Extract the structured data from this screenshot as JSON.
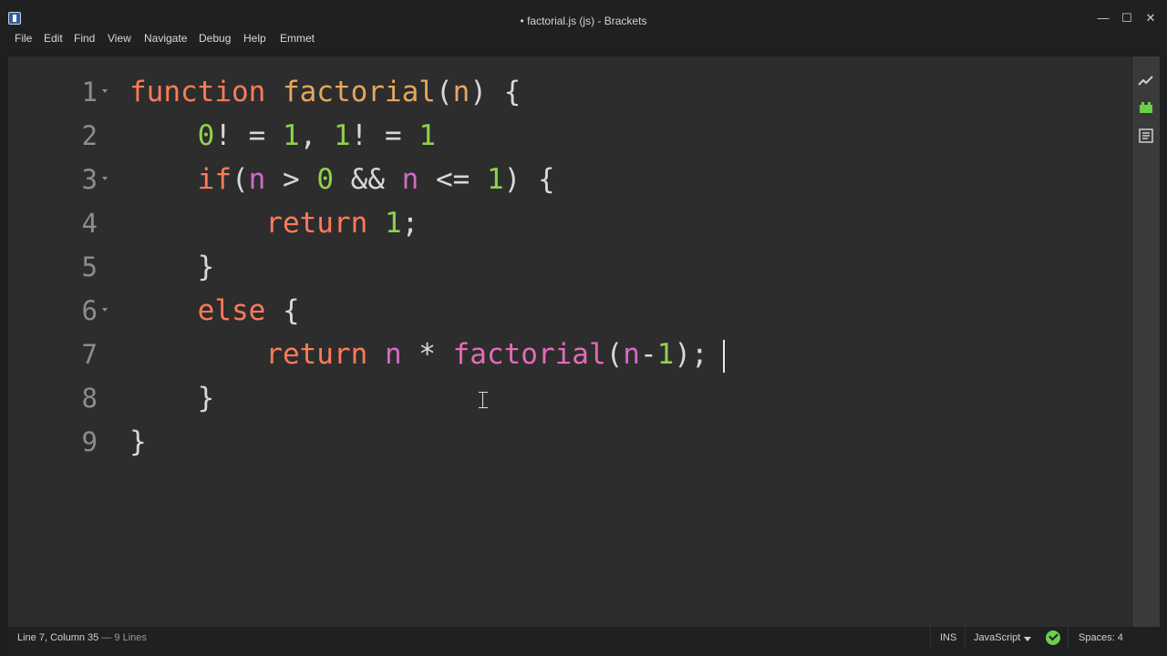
{
  "window": {
    "title": "• factorial.js (js) - Brackets",
    "controls": {
      "minimize": "—",
      "maximize": "☐",
      "close": "✕"
    }
  },
  "menu": [
    "File",
    "Edit",
    "Find",
    "View",
    "Navigate",
    "Debug",
    "Help",
    "Emmet"
  ],
  "editor": {
    "lines": [
      {
        "n": "1",
        "indent": "",
        "tokens": [
          [
            "kw",
            "function"
          ],
          [
            "op",
            " "
          ],
          [
            "fn",
            "factorial"
          ],
          [
            "op",
            "("
          ],
          [
            "fn",
            "n"
          ],
          [
            "op",
            ") {"
          ]
        ],
        "fold": true
      },
      {
        "n": "2",
        "indent": "    ",
        "tokens": [
          [
            "num",
            "0"
          ],
          [
            "op",
            "! = "
          ],
          [
            "num",
            "1"
          ],
          [
            "op",
            ", "
          ],
          [
            "num",
            "1"
          ],
          [
            "op",
            "! = "
          ],
          [
            "num",
            "1"
          ]
        ],
        "fold": false
      },
      {
        "n": "3",
        "indent": "    ",
        "tokens": [
          [
            "kw",
            "if"
          ],
          [
            "op",
            "("
          ],
          [
            "var",
            "n"
          ],
          [
            "op",
            " > "
          ],
          [
            "num",
            "0"
          ],
          [
            "op",
            " && "
          ],
          [
            "var",
            "n"
          ],
          [
            "op",
            " <= "
          ],
          [
            "num",
            "1"
          ],
          [
            "op",
            ") {"
          ]
        ],
        "fold": true
      },
      {
        "n": "4",
        "indent": "        ",
        "tokens": [
          [
            "kw",
            "return"
          ],
          [
            "op",
            " "
          ],
          [
            "num",
            "1"
          ],
          [
            "op",
            ";"
          ]
        ],
        "fold": false
      },
      {
        "n": "5",
        "indent": "    ",
        "tokens": [
          [
            "op",
            "}"
          ]
        ],
        "fold": false
      },
      {
        "n": "6",
        "indent": "    ",
        "tokens": [
          [
            "kw",
            "else"
          ],
          [
            "op",
            " {"
          ]
        ],
        "fold": true
      },
      {
        "n": "7",
        "indent": "        ",
        "tokens": [
          [
            "kw",
            "return"
          ],
          [
            "op",
            " "
          ],
          [
            "var",
            "n"
          ],
          [
            "op",
            " * "
          ],
          [
            "call",
            "factorial"
          ],
          [
            "op",
            "("
          ],
          [
            "var",
            "n"
          ],
          [
            "op",
            "-"
          ],
          [
            "num",
            "1"
          ],
          [
            "op",
            ");"
          ]
        ],
        "fold": false
      },
      {
        "n": "8",
        "indent": "    ",
        "tokens": [
          [
            "op",
            "}"
          ]
        ],
        "fold": false
      },
      {
        "n": "9",
        "indent": "",
        "tokens": [
          [
            "op",
            "}"
          ]
        ],
        "fold": false
      }
    ]
  },
  "statusbar": {
    "position": "Line 7, Column 35",
    "lines_count": "— 9 Lines",
    "mode": "INS",
    "language": "JavaScript",
    "spaces": "Spaces: 4",
    "lint_color": "#6ccf49"
  },
  "toolbar": {
    "icons": [
      "live-preview-icon",
      "extension-manager-icon",
      "file-outline-icon"
    ]
  }
}
